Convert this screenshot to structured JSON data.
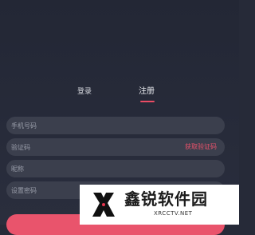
{
  "tabs": {
    "login_label": "登录",
    "register_label": "注册",
    "active": "register"
  },
  "form": {
    "phone_placeholder": "手机号码",
    "code_placeholder": "验证码",
    "get_code_label": "获取验证码",
    "nickname_placeholder": "昵称",
    "password_placeholder": "设置密码"
  },
  "watermark": {
    "title": "鑫锐软件园",
    "subtitle": "XRCCTV.NET"
  },
  "colors": {
    "background": "#262a38",
    "field": "#3b3f4d",
    "accent": "#ea4c64",
    "placeholder": "#9a9eaa"
  }
}
